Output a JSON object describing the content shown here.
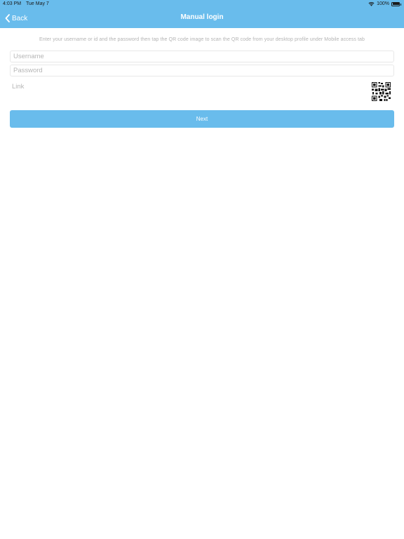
{
  "status_bar": {
    "time": "4:03 PM",
    "date": "Tue May 7",
    "battery": "100%",
    "wifi_icon": "wifi-icon",
    "battery_icon": "battery-icon"
  },
  "nav": {
    "back_label": "Back",
    "back_icon": "chevron-left-icon",
    "title": "Manual login"
  },
  "instructions": "Enter your username or id and the password then tap the QR code image to scan the QR code from your desktop profile under Mobile access tab",
  "form": {
    "username_placeholder": "Username",
    "password_placeholder": "Password",
    "link_label": "Link",
    "qr_icon": "qr-code-icon",
    "next_label": "Next"
  },
  "colors": {
    "accent": "#69bcec",
    "placeholder": "#b6b6b6",
    "background": "#ffffff"
  }
}
